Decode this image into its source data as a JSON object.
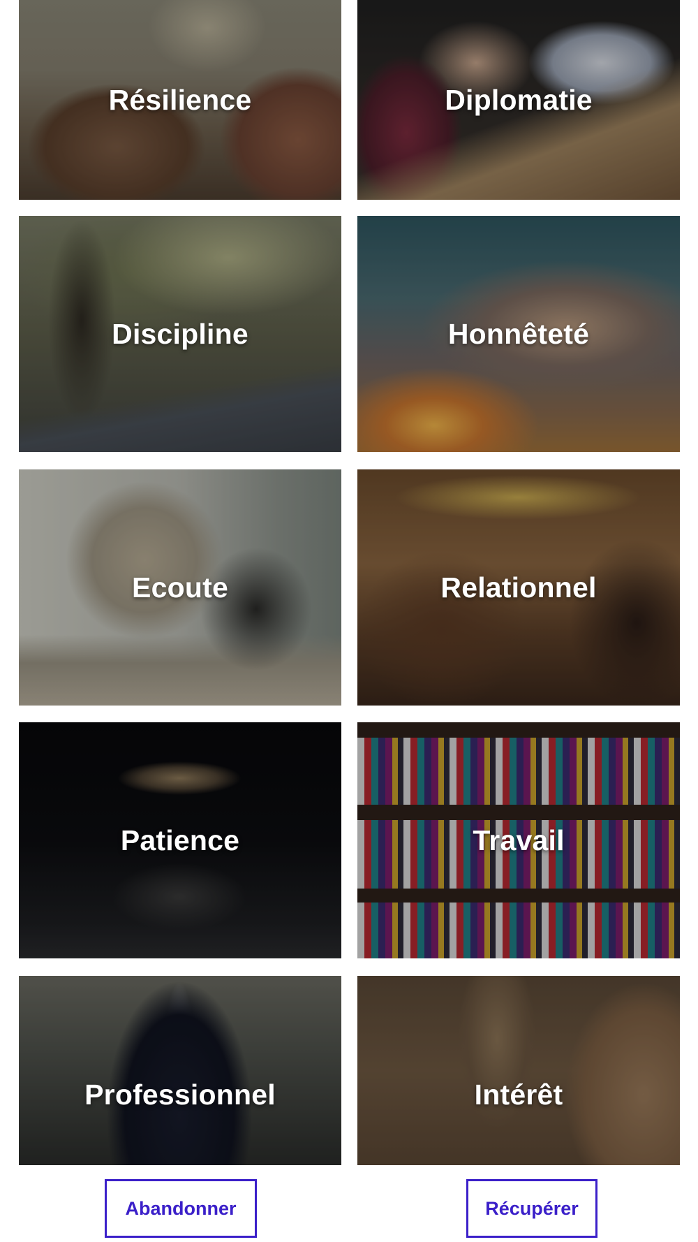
{
  "tiles": [
    {
      "label": "Résilience"
    },
    {
      "label": "Diplomatie"
    },
    {
      "label": "Discipline"
    },
    {
      "label": "Honnêteté"
    },
    {
      "label": "Ecoute"
    },
    {
      "label": "Relationnel"
    },
    {
      "label": "Patience"
    },
    {
      "label": "Travail"
    },
    {
      "label": "Professionnel"
    },
    {
      "label": "Intérêt"
    }
  ],
  "actions": {
    "abandon_label": "Abandonner",
    "recover_label": "Récupérer"
  },
  "colors": {
    "accent": "#3b20c9",
    "tile_label": "#ffffff"
  }
}
